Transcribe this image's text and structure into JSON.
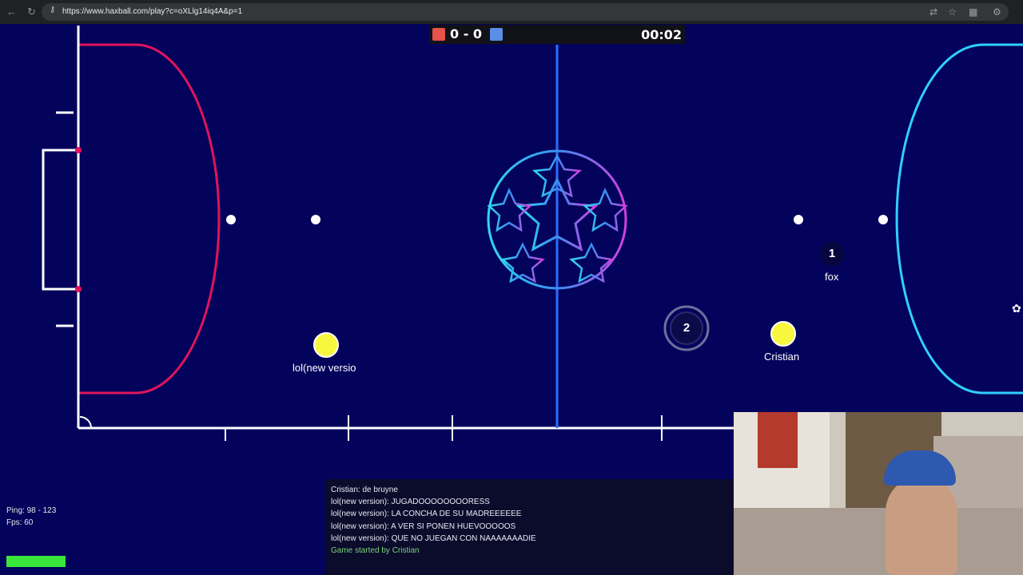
{
  "browser": {
    "url": "https://www.haxball.com/play?c=oXLlg14iq4A&p=1",
    "icons": [
      "back-arrow-icon",
      "reload-icon",
      "lock-icon",
      "translate-icon",
      "star-icon",
      "extensions-icon",
      "settings-icon"
    ]
  },
  "scoreboard": {
    "score": "0 - 0",
    "time": "00:02",
    "red_color": "#e5534b",
    "blue_color": "#5b8ee6"
  },
  "players": [
    {
      "name": "lol(new versio",
      "number": "",
      "color": "#f7f740"
    },
    {
      "name": "Cristian",
      "number": "",
      "color": "#f7f740"
    },
    {
      "name": "fox",
      "number": "1",
      "color": "#06063e"
    },
    {
      "name": "",
      "number": "2",
      "color": "#0b0b4a"
    }
  ],
  "chat": {
    "messages": [
      "Cristian: de bruyne",
      "lol(new version): JUGADOOOOOOOORESS",
      "lol(new version): LA CONCHA DE SU MADREEEEEE",
      "lol(new version): A VER SI PONEN HUEVOOOOOS",
      "lol(new version): QUE NO JUEGAN CON NAAAAAAADIE"
    ],
    "system": "Game started by Cristian"
  },
  "stats": {
    "ping": "Ping: 98 - 123",
    "fps": "Fps: 60"
  },
  "colors": {
    "field_bg": "#03035c",
    "red_line": "#e0145c",
    "blue_line": "#30d0ff",
    "center_line": "#2b6cff"
  }
}
